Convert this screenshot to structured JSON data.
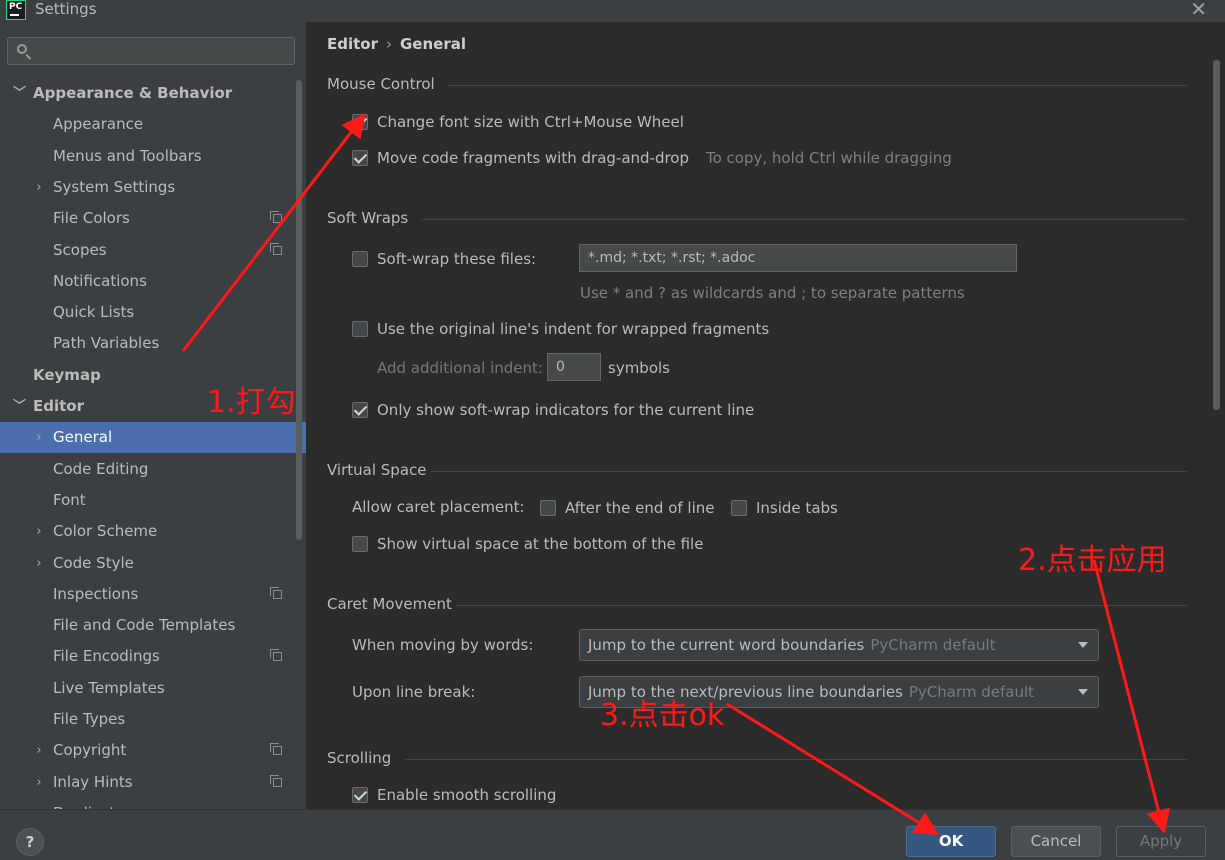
{
  "window": {
    "title": "Settings",
    "logo_text": "PC"
  },
  "search": {
    "placeholder": ""
  },
  "sidebar": {
    "items": [
      {
        "label": "Appearance & Behavior",
        "arrow": "﹀",
        "bold": true,
        "selected": false,
        "proj": false
      },
      {
        "label": "Appearance",
        "arrow": "",
        "bold": false,
        "selected": false,
        "proj": false
      },
      {
        "label": "Menus and Toolbars",
        "arrow": "",
        "bold": false,
        "selected": false,
        "proj": false
      },
      {
        "label": "System Settings",
        "arrow": "›",
        "bold": false,
        "selected": false,
        "proj": false
      },
      {
        "label": "File Colors",
        "arrow": "",
        "bold": false,
        "selected": false,
        "proj": true
      },
      {
        "label": "Scopes",
        "arrow": "",
        "bold": false,
        "selected": false,
        "proj": true
      },
      {
        "label": "Notifications",
        "arrow": "",
        "bold": false,
        "selected": false,
        "proj": false
      },
      {
        "label": "Quick Lists",
        "arrow": "",
        "bold": false,
        "selected": false,
        "proj": false
      },
      {
        "label": "Path Variables",
        "arrow": "",
        "bold": false,
        "selected": false,
        "proj": false
      },
      {
        "label": "Keymap",
        "arrow": "",
        "bold": true,
        "selected": false,
        "proj": false
      },
      {
        "label": "Editor",
        "arrow": "﹀",
        "bold": true,
        "selected": false,
        "proj": false
      },
      {
        "label": "General",
        "arrow": "›",
        "bold": false,
        "selected": true,
        "proj": false
      },
      {
        "label": "Code Editing",
        "arrow": "",
        "bold": false,
        "selected": false,
        "proj": false
      },
      {
        "label": "Font",
        "arrow": "",
        "bold": false,
        "selected": false,
        "proj": false
      },
      {
        "label": "Color Scheme",
        "arrow": "›",
        "bold": false,
        "selected": false,
        "proj": false
      },
      {
        "label": "Code Style",
        "arrow": "›",
        "bold": false,
        "selected": false,
        "proj": false
      },
      {
        "label": "Inspections",
        "arrow": "",
        "bold": false,
        "selected": false,
        "proj": true
      },
      {
        "label": "File and Code Templates",
        "arrow": "",
        "bold": false,
        "selected": false,
        "proj": false
      },
      {
        "label": "File Encodings",
        "arrow": "",
        "bold": false,
        "selected": false,
        "proj": true
      },
      {
        "label": "Live Templates",
        "arrow": "",
        "bold": false,
        "selected": false,
        "proj": false
      },
      {
        "label": "File Types",
        "arrow": "",
        "bold": false,
        "selected": false,
        "proj": false
      },
      {
        "label": "Copyright",
        "arrow": "›",
        "bold": false,
        "selected": false,
        "proj": true
      },
      {
        "label": "Inlay Hints",
        "arrow": "›",
        "bold": false,
        "selected": false,
        "proj": true
      },
      {
        "label": "Duplicates",
        "arrow": "",
        "bold": false,
        "selected": false,
        "proj": false
      }
    ]
  },
  "breadcrumb": {
    "parent": "Editor",
    "separator": "›",
    "current": "General"
  },
  "mouse_control": {
    "title": "Mouse Control",
    "ctrl_wheel": {
      "label": "Change font size with Ctrl+Mouse Wheel",
      "checked": true
    },
    "drag_drop": {
      "label": "Move code fragments with drag-and-drop",
      "checked": true,
      "hint": "To copy, hold Ctrl while dragging"
    }
  },
  "soft_wraps": {
    "title": "Soft Wraps",
    "files": {
      "label": "Soft-wrap these files:",
      "checked": false,
      "value": "*.md; *.txt; *.rst; *.adoc",
      "hint": "Use * and ? as wildcards and ; to separate patterns"
    },
    "original_indent": {
      "label": "Use the original line's indent for wrapped fragments",
      "checked": false
    },
    "additional_indent": {
      "label": "Add additional indent:",
      "value": "0",
      "unit": "symbols"
    },
    "indicators": {
      "label": "Only show soft-wrap indicators for the current line",
      "checked": true
    }
  },
  "virtual_space": {
    "title": "Virtual Space",
    "caret_label": "Allow caret placement:",
    "after_end": {
      "label": "After the end of line",
      "checked": false
    },
    "inside_tabs": {
      "label": "Inside tabs",
      "checked": false
    },
    "bottom": {
      "label": "Show virtual space at the bottom of the file",
      "checked": false
    }
  },
  "caret_movement": {
    "title": "Caret Movement",
    "by_words": {
      "label": "When moving by words:",
      "value": "Jump to the current word boundaries",
      "default": "PyCharm default"
    },
    "line_break": {
      "label": "Upon line break:",
      "value": "Jump to the next/previous line boundaries",
      "default": "PyCharm default"
    }
  },
  "scrolling": {
    "title": "Scrolling",
    "smooth": {
      "label": "Enable smooth scrolling",
      "checked": true
    }
  },
  "buttons": {
    "help": "?",
    "ok": "OK",
    "cancel": "Cancel",
    "apply": "Apply"
  },
  "annotations": {
    "step1": "1.打勾",
    "step2": "2.点击应用",
    "step3": "3.点击ok"
  },
  "colors": {
    "accent": "#4b6eaf",
    "annotation": "#ff1a1a",
    "ok_button": "#365880"
  }
}
